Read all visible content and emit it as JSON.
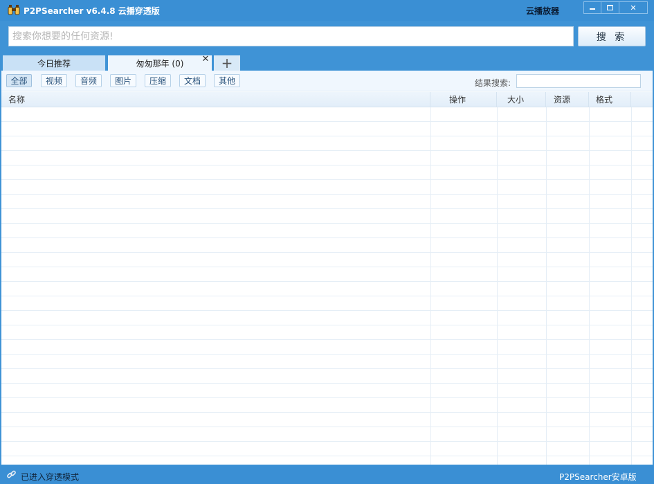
{
  "titlebar": {
    "title": "P2PSearcher v6.4.8 云播穿透版",
    "cloud_player": "云播放器",
    "app_icon": "binoculars-icon",
    "close_symbol": "✕"
  },
  "search": {
    "placeholder": "搜索你想要的任何资源!",
    "button_label": "搜 索"
  },
  "tabs": [
    {
      "label": "今日推荐"
    },
    {
      "label": "匆匆那年 (0)",
      "close_symbol": "✕"
    }
  ],
  "add_tab_symbol": "+",
  "filters": [
    {
      "label": "全部",
      "active": true
    },
    {
      "label": "视频"
    },
    {
      "label": "音频"
    },
    {
      "label": "图片"
    },
    {
      "label": "压缩"
    },
    {
      "label": "文档"
    },
    {
      "label": "其他"
    }
  ],
  "result_search": {
    "label": "结果搜索:"
  },
  "table": {
    "columns": [
      "名称",
      "操作",
      "大小",
      "资源",
      "格式"
    ],
    "rows": []
  },
  "status": {
    "text": "已进入穿透模式",
    "android_link": "P2PSearcher安卓版",
    "icon": "link-icon"
  },
  "colors": {
    "accent": "#3a8fd4",
    "panel": "#f0f7fe"
  }
}
